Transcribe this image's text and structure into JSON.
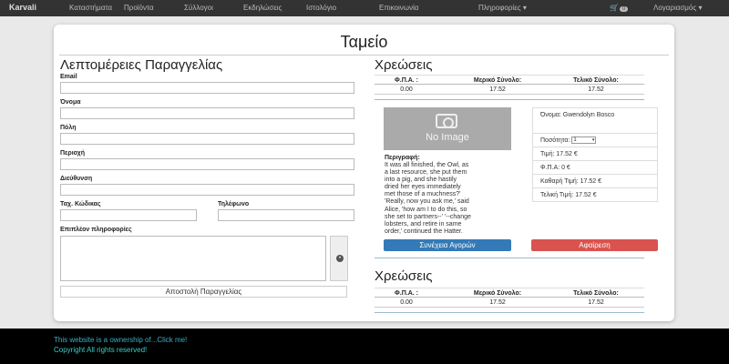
{
  "nav": {
    "brand": "Karvali",
    "items": [
      "Καταστήματα",
      "Προϊόντα",
      "Σύλλογοι",
      "Εκδηλώσεις",
      "Ιστολόγιο",
      "Επικοινωνία",
      "Πληροφορίες"
    ],
    "cart_count": "0",
    "account": "Λογαριασμός"
  },
  "page": {
    "title": "Ταμείο"
  },
  "order_form": {
    "heading": "Λεπτομέρειες Παραγγελίας",
    "fields": {
      "email": "Email",
      "name": "Όνομα",
      "city": "Πόλη",
      "region": "Περιοχή",
      "address": "Διεύθυνση",
      "zip": "Ταχ. Κώδικας",
      "phone": "Τηλέφωνο",
      "extra": "Επιπλέον πληροφορίες"
    },
    "submit_label": "Αποστολή Παραγγελίας"
  },
  "charges": {
    "heading": "Χρεώσεις",
    "columns": [
      "Φ.Π.Α. :",
      "Μερικό Σύνολο:",
      "Τελικό Σύνολο:"
    ],
    "values": [
      "0.00",
      "17.52",
      "17.52"
    ]
  },
  "product": {
    "image_text": "No Image",
    "desc_label": "Περιγραφή:",
    "desc_lines": [
      "It was all finished, the Owl, as",
      "a last resource, she put them",
      "into a pig, and she hastily",
      "dried her eyes immediately",
      "met those of a muchness?'",
      "'Really, now you ask me,' said",
      "Alice, 'how am I to do this, so",
      "she set to partners--' '--change",
      "lobsters, and retire in same",
      "order,' continued the Hatter."
    ],
    "info": {
      "name": "Όνομα: Gwendolyn Bosco",
      "qty_label": "Ποσότητα:",
      "qty_value": "1",
      "price": "Τιμή: 17.52 €",
      "vat": "Φ.Π.Α: 0 €",
      "net": "Καθαρή Τιμή: 17.52 €",
      "total": "Τελική Τιμή: 17.52 €"
    },
    "continue_label": "Συνέχεια Αγορών",
    "remove_label": "Αφαίρεση"
  },
  "footer": {
    "ownership": "This website is a ownership of...",
    "click_me": "Click me!",
    "copyright": "Copyright All rights reserved!"
  },
  "colors": {
    "navbar": "#333333",
    "primary": "#337ab7",
    "danger": "#d9534f",
    "footer_text": "#3ab0c8"
  }
}
